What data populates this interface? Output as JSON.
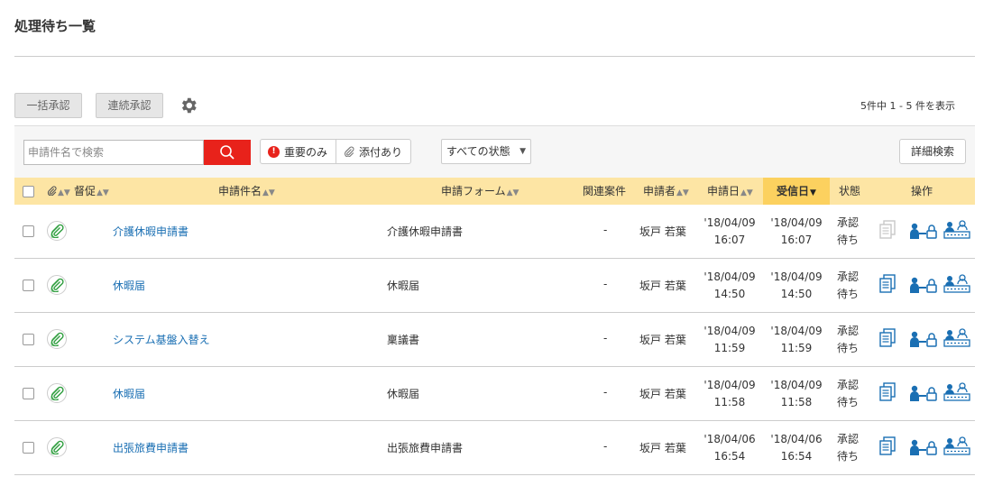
{
  "page": {
    "title": "処理待ち一覧"
  },
  "toolbar": {
    "bulk_approve": "一括承認",
    "continuous_approve": "連続承認",
    "count_text": "5件中 1 - 5 件を表示"
  },
  "filter": {
    "search_placeholder": "申請件名で検索",
    "important_label": "重要のみ",
    "attachment_label": "添付あり",
    "status_selected": "すべての状態",
    "advanced_search": "詳細検索"
  },
  "table": {
    "headers": {
      "reminder": "督促",
      "subject": "申請件名",
      "form": "申請フォーム",
      "related": "関連案件",
      "applicant": "申請者",
      "apply_date": "申請日",
      "received_date": "受信日",
      "status": "状態",
      "actions": "操作"
    },
    "rows": [
      {
        "subject": "介護休暇申請書",
        "form": "介護休暇申請書",
        "related": "-",
        "applicant": "坂戸 若葉",
        "apply_date": "'18/04/09",
        "apply_time": "16:07",
        "received_date": "'18/04/09",
        "received_time": "16:07",
        "status_1": "承認",
        "status_2": "待ち",
        "doc_icon_active": false
      },
      {
        "subject": "休暇届",
        "form": "休暇届",
        "related": "-",
        "applicant": "坂戸 若葉",
        "apply_date": "'18/04/09",
        "apply_time": "14:50",
        "received_date": "'18/04/09",
        "received_time": "14:50",
        "status_1": "承認",
        "status_2": "待ち",
        "doc_icon_active": true
      },
      {
        "subject": "システム基盤入替え",
        "form": "稟議書",
        "related": "-",
        "applicant": "坂戸 若葉",
        "apply_date": "'18/04/09",
        "apply_time": "11:59",
        "received_date": "'18/04/09",
        "received_time": "11:59",
        "status_1": "承認",
        "status_2": "待ち",
        "doc_icon_active": true
      },
      {
        "subject": "休暇届",
        "form": "休暇届",
        "related": "-",
        "applicant": "坂戸 若葉",
        "apply_date": "'18/04/09",
        "apply_time": "11:58",
        "received_date": "'18/04/09",
        "received_time": "11:58",
        "status_1": "承認",
        "status_2": "待ち",
        "doc_icon_active": true
      },
      {
        "subject": "出張旅費申請書",
        "form": "出張旅費申請書",
        "related": "-",
        "applicant": "坂戸 若葉",
        "apply_date": "'18/04/06",
        "apply_time": "16:54",
        "received_date": "'18/04/06",
        "received_time": "16:54",
        "status_1": "承認",
        "status_2": "待ち",
        "doc_icon_active": true
      }
    ]
  },
  "colors": {
    "accent_red": "#e8221b",
    "header_bg": "#fde5a4",
    "header_active": "#fcd15f",
    "link": "#1a6fb3",
    "icon_blue": "#1a6fb3",
    "clip_green": "#2e9e3e"
  }
}
